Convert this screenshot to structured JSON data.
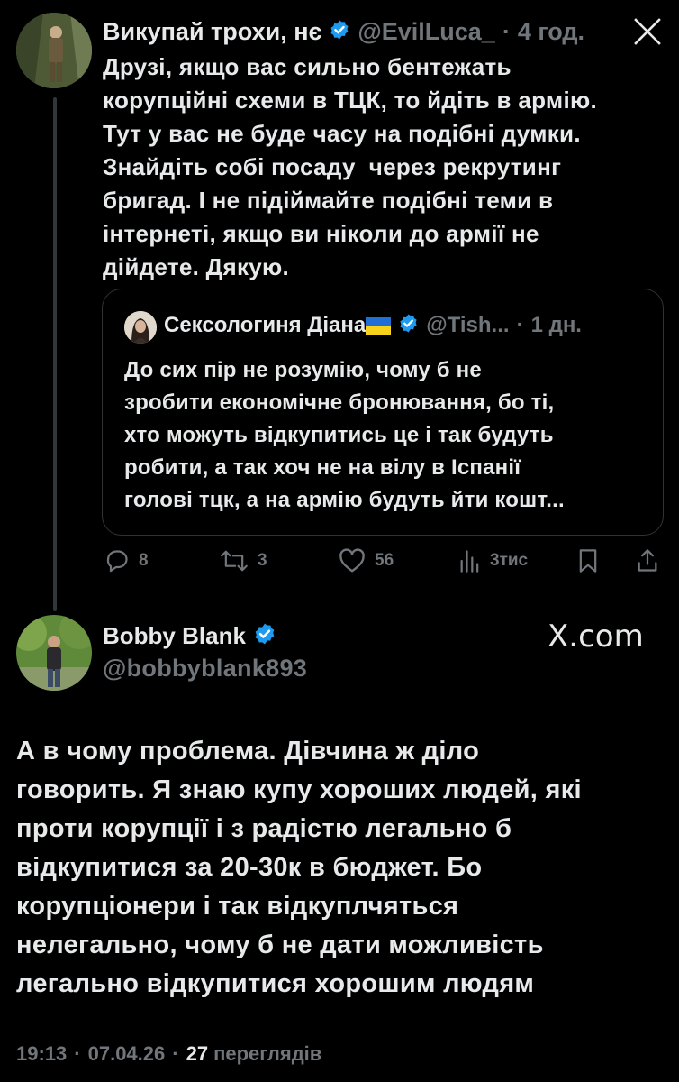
{
  "reply_tweet": {
    "author_name": "Викупай трохи, нє",
    "author_handle": "@EvilLuca_",
    "time": "4 год.",
    "text_lines": [
      "Друзі, якщо вас сильно бентежать",
      "корупційні схеми в ТЦК, то йдіть в армію.",
      "Тут у вас не буде часу на подібні думки.",
      "Знайдіть собі посаду  через рекрутинг",
      "бригад. І не підіймайте подібні теми в",
      "інтернеті, якщо ви ніколи до армії не",
      "дійдете. Дякую."
    ],
    "actions": {
      "replies": "8",
      "reposts": "3",
      "likes": "56",
      "views": "3тис"
    }
  },
  "quoted_tweet": {
    "author_name": "Сексологиня Діана",
    "author_handle": "@Tish...",
    "time": "1 дн.",
    "text_lines": [
      "До сих пір не розумію, чому б не",
      "зробити економічне бронювання, бо ті,",
      "хто можуть відкупитись це і так будуть",
      "робити, а так хоч не на вілу в Іспанії",
      "голові тцк, а на армію будуть йти кошт..."
    ]
  },
  "main_tweet": {
    "author_name": "Bobby Blank",
    "author_handle": "@bobbyblank893",
    "watermark": "X.com",
    "text_lines": [
      "А в чому проблема. Дівчина ж діло",
      "говорить. Я знаю купу хороших людей, які",
      "проти корупції і з радістю легально б",
      "відкупитися за 20-30к в бюджет. Бо",
      "корупціонери і так відкуплчяться",
      "нелегально, чому б не дати можливість",
      "легально відкупитися хорошим людям"
    ],
    "time": "19:13",
    "date": "07.04.26",
    "views_count": "27",
    "views_label": "переглядів"
  },
  "colors": {
    "background": "#000000",
    "text": "#e7e9ea",
    "muted": "#71767b",
    "verified": "#1d9bf0",
    "divider": "#2f3336"
  },
  "icons": [
    "close-icon",
    "verified-icon",
    "reply-icon",
    "repost-icon",
    "like-icon",
    "views-icon",
    "bookmark-icon",
    "share-icon",
    "ukraine-flag-icon"
  ]
}
